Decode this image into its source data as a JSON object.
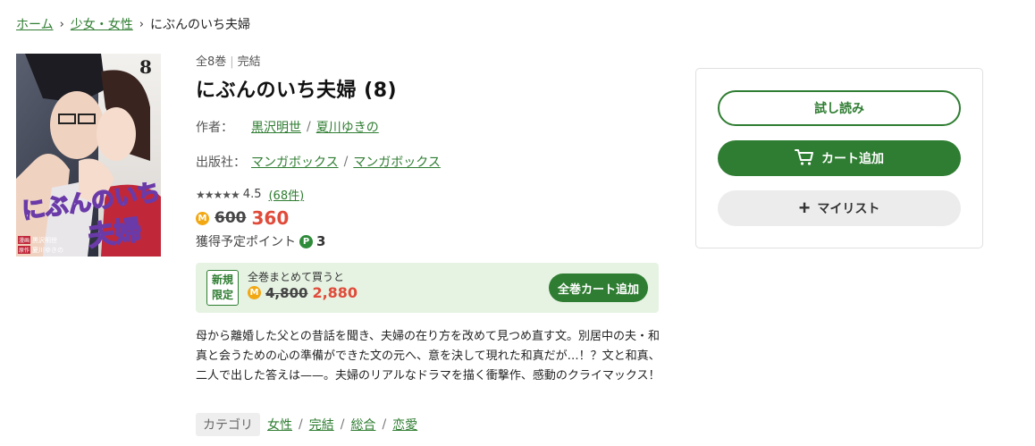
{
  "breadcrumb": {
    "home": "ホーム",
    "category": "少女・女性",
    "current": "にぶんのいち夫婦"
  },
  "book": {
    "volume_info": "全8巻",
    "status": "完結",
    "title": "にぶんのいち夫婦 (8)",
    "author_label": "作者：",
    "authors": [
      "黒沢明世",
      "夏川ゆきの"
    ],
    "publisher_label": "出版社：",
    "publishers": [
      "マンガボックス",
      "マンガボックス"
    ],
    "rating": "4.5",
    "review_count": "(68件)",
    "rating_stars": 4.5,
    "coin_icon_text": "M",
    "original_price": "600",
    "sale_price": "360",
    "points_label": "獲得予定ポイント",
    "points_icon_text": "P",
    "points_value": "3"
  },
  "cover": {
    "volume_number": "8",
    "title_line1": "にぶんのいち",
    "title_line2": "夫婦",
    "credit_author_role": "漫画",
    "credit_author": "黒沢明世",
    "credit_writer_role": "原作",
    "credit_writer": "夏川ゆきの"
  },
  "promo": {
    "tag_line1": "新規",
    "tag_line2": "限定",
    "text": "全巻まとめて買うと",
    "original_price": "4,800",
    "sale_price": "2,880",
    "button_label": "全巻カート追加"
  },
  "description": "母から離婚した父との昔話を聞き、夫婦の在り方を改めて見つめ直す文。別居中の夫・和真と会うための心の準備ができた文の元へ、意を決して現れた和真だが…！？文と和真、二人で出した答えは——。夫婦のリアルなドラマを描く衝撃作、感動のクライマックス！",
  "categories": {
    "label": "カテゴリ",
    "items": [
      "女性",
      "完結",
      "総合",
      "恋愛"
    ]
  },
  "actions": {
    "trial": "試し読み",
    "cart": "カート追加",
    "mylist": "マイリスト"
  },
  "colors": {
    "accent": "#2f7d32",
    "price": "#e04b3a",
    "coin": "#f2a813"
  }
}
